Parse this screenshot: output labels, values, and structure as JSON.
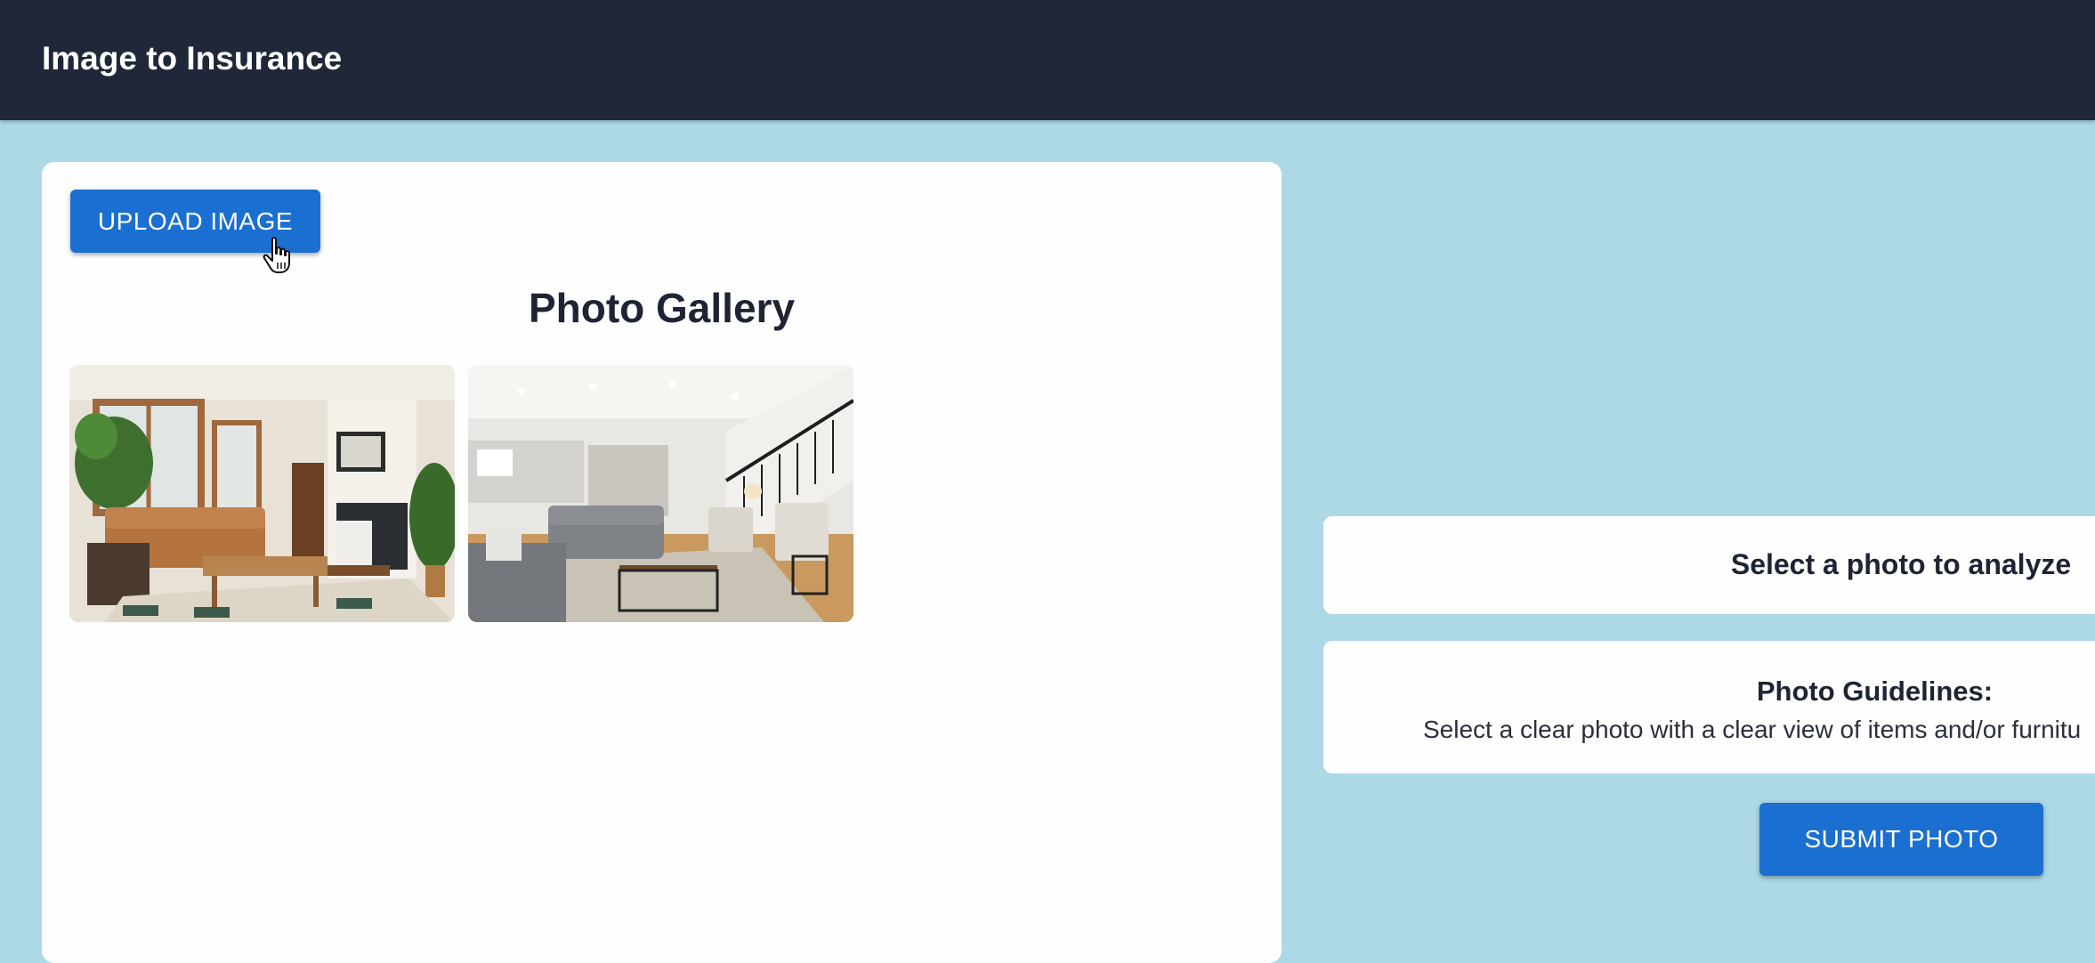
{
  "header": {
    "title": "Image to Insurance"
  },
  "upload": {
    "label": "UPLOAD IMAGE"
  },
  "gallery": {
    "title": "Photo Gallery",
    "photos": [
      {
        "name": "living-room-photo-1"
      },
      {
        "name": "living-room-photo-2"
      }
    ]
  },
  "analysis": {
    "prompt": "Select a photo to analyze"
  },
  "guidelines": {
    "title": "Photo Guidelines:",
    "text": "Select a clear photo with a clear view of items and/or furnitu"
  },
  "submit": {
    "label": "SUBMIT PHOTO"
  },
  "colors": {
    "header_bg": "#1f2739",
    "page_bg": "#add8e6",
    "button_bg": "#1a6fd0",
    "card_bg": "#fefefe"
  }
}
